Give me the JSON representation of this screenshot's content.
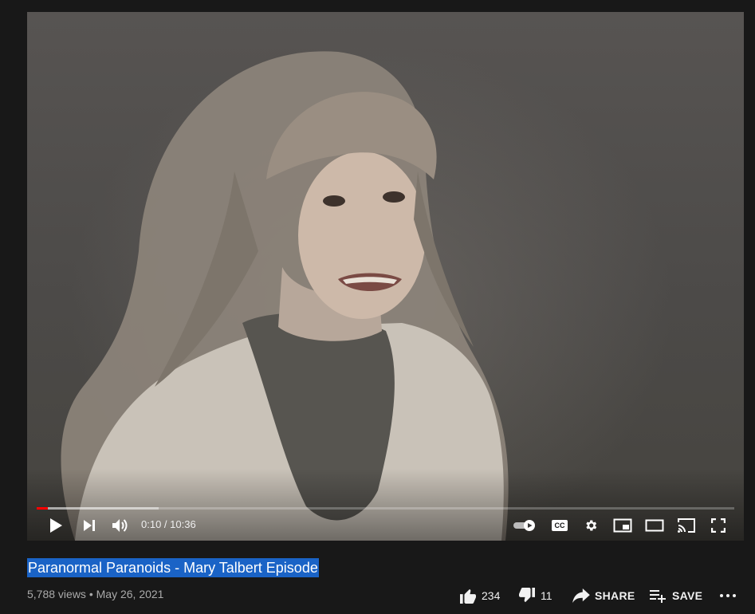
{
  "player": {
    "time": "0:10 / 10:36",
    "progress_played": 0.016,
    "progress_loaded": 0.175
  },
  "video": {
    "title": "Paranormal Paranoids - Mary Talbert Episode",
    "views": "5,788 views",
    "separator": "•",
    "date": "May 26, 2021"
  },
  "actions": {
    "likes": "234",
    "dislikes": "11",
    "share": "SHARE",
    "save": "SAVE"
  },
  "icons": {
    "play": "play-icon",
    "next": "next-icon",
    "volume": "volume-icon",
    "autoplay": "autoplay-toggle-icon",
    "cc": "cc-icon",
    "cc_label": "CC",
    "settings": "gear-icon",
    "miniplayer": "miniplayer-icon",
    "theater": "theater-icon",
    "cast": "cast-icon",
    "fullscreen": "fullscreen-icon",
    "like": "thumbs-up-icon",
    "dislike": "thumbs-down-icon",
    "share": "share-icon",
    "save": "playlist-add-icon",
    "more": "more-icon"
  },
  "colors": {
    "background": "#181818",
    "progress_played": "#ff0000",
    "title_highlight": "#1a63c6"
  }
}
